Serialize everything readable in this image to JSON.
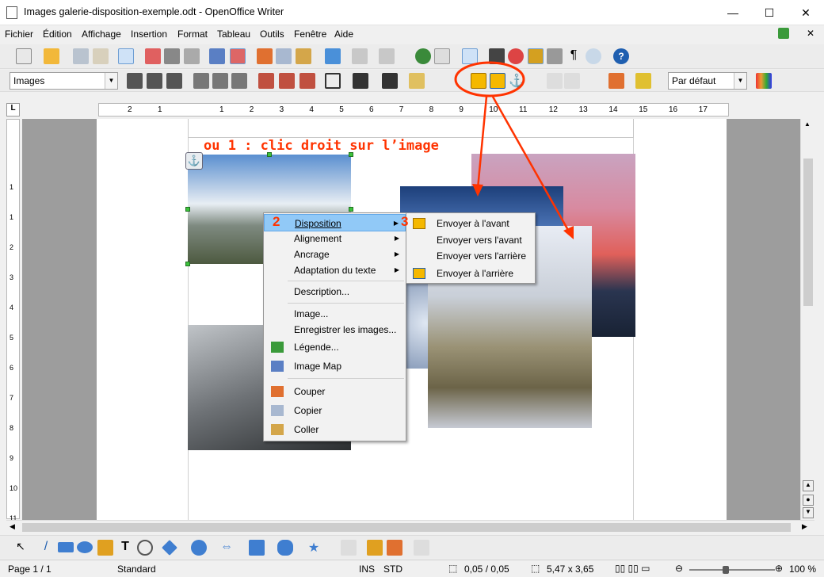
{
  "window": {
    "title": "Images galerie-disposition-exemple.odt - OpenOffice Writer",
    "minimize": "—",
    "maximize": "☐",
    "close": "✕"
  },
  "menu": [
    "Fichier",
    "Édition",
    "Affichage",
    "Insertion",
    "Format",
    "Tableau",
    "Outils",
    "Fenêtre",
    "Aide"
  ],
  "format_bar": {
    "style_value": "Images",
    "anchor_style_value": "Par défaut"
  },
  "ruler": {
    "ticks": [
      "2",
      "1",
      "1",
      "2",
      "3",
      "4",
      "5",
      "6",
      "7",
      "8",
      "9",
      "10",
      "11",
      "12",
      "13",
      "14",
      "15",
      "16",
      "17"
    ]
  },
  "vruler": {
    "ticks": [
      "1",
      "1",
      "2",
      "3",
      "4",
      "5",
      "6",
      "7",
      "8",
      "9",
      "10",
      "11"
    ]
  },
  "annotations": {
    "note1": "ou 1 : clic droit sur l’image",
    "step2": "2",
    "step3": "3",
    "accent": "#ff3300"
  },
  "context_menu": {
    "items": [
      "Disposition",
      "Alignement",
      "Ancrage",
      "Adaptation du texte",
      "Description...",
      "Image...",
      "Enregistrer les images...",
      "Légende...",
      "Image Map",
      "Couper",
      "Copier",
      "Coller"
    ]
  },
  "submenu": {
    "items": [
      "Envoyer à l'avant",
      "Envoyer vers l'avant",
      "Envoyer vers l'arrière",
      "Envoyer à l'arrière"
    ]
  },
  "status": {
    "page": "Page 1 / 1",
    "style": "Standard",
    "ins": "INS",
    "std": "STD",
    "position": "0,05 / 0,05",
    "size": "5,47 x 3,65",
    "zoom": "100 %"
  }
}
